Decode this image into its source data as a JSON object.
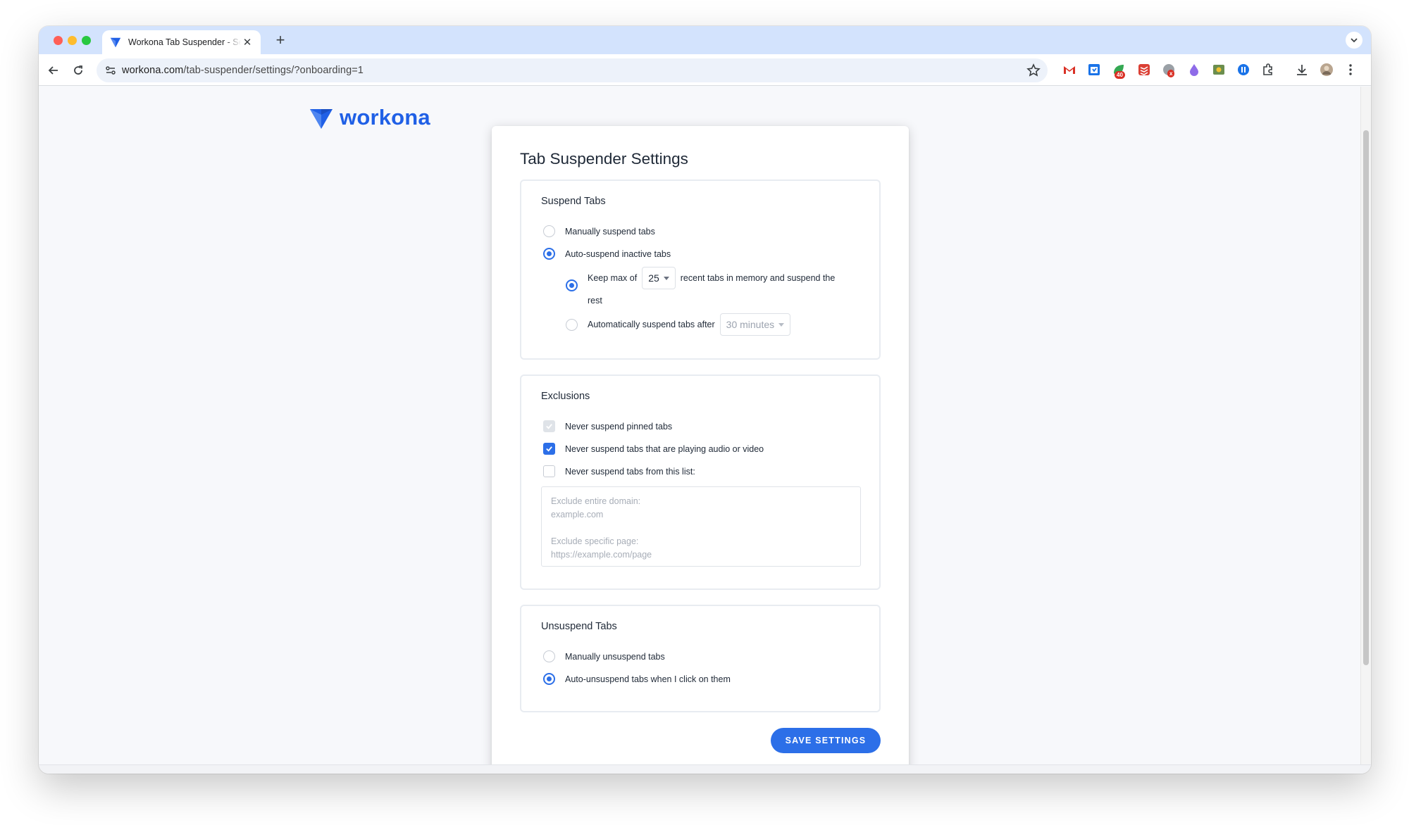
{
  "browser": {
    "tab_title": "Workona Tab Suspender - Settings",
    "new_tab_label": "+",
    "url_domain": "workona.com",
    "url_path": "/tab-suspender/settings/?onboarding=1",
    "extension_badges": {
      "ext3": "40",
      "ext5": "x"
    }
  },
  "brand": {
    "name": "workona",
    "color": "#2060e6"
  },
  "settings": {
    "title": "Tab Suspender Settings",
    "suspend": {
      "title": "Suspend Tabs",
      "manual_label": "Manually suspend tabs",
      "auto_label": "Auto-suspend inactive tabs",
      "keep_max_prefix": "Keep max of",
      "keep_max_value": "25",
      "keep_max_suffix_line1": "recent tabs in memory and suspend the",
      "keep_max_suffix_line2": "rest",
      "auto_after_label": "Automatically suspend tabs after",
      "auto_after_value": "30 minutes"
    },
    "exclusions": {
      "title": "Exclusions",
      "pinned_label": "Never suspend pinned tabs",
      "audio_label": "Never suspend tabs that are playing audio or video",
      "list_label": "Never suspend tabs from this list:",
      "list_placeholder": "Exclude entire domain:\nexample.com\n\nExclude specific page:\nhttps://example.com/page"
    },
    "unsuspend": {
      "title": "Unsuspend Tabs",
      "manual_label": "Manually unsuspend tabs",
      "auto_label": "Auto-unsuspend tabs when I click on them"
    },
    "save_label": "SAVE SETTINGS"
  },
  "colors": {
    "accent": "#2c6fe8",
    "tabstrip": "#d3e3fd"
  }
}
